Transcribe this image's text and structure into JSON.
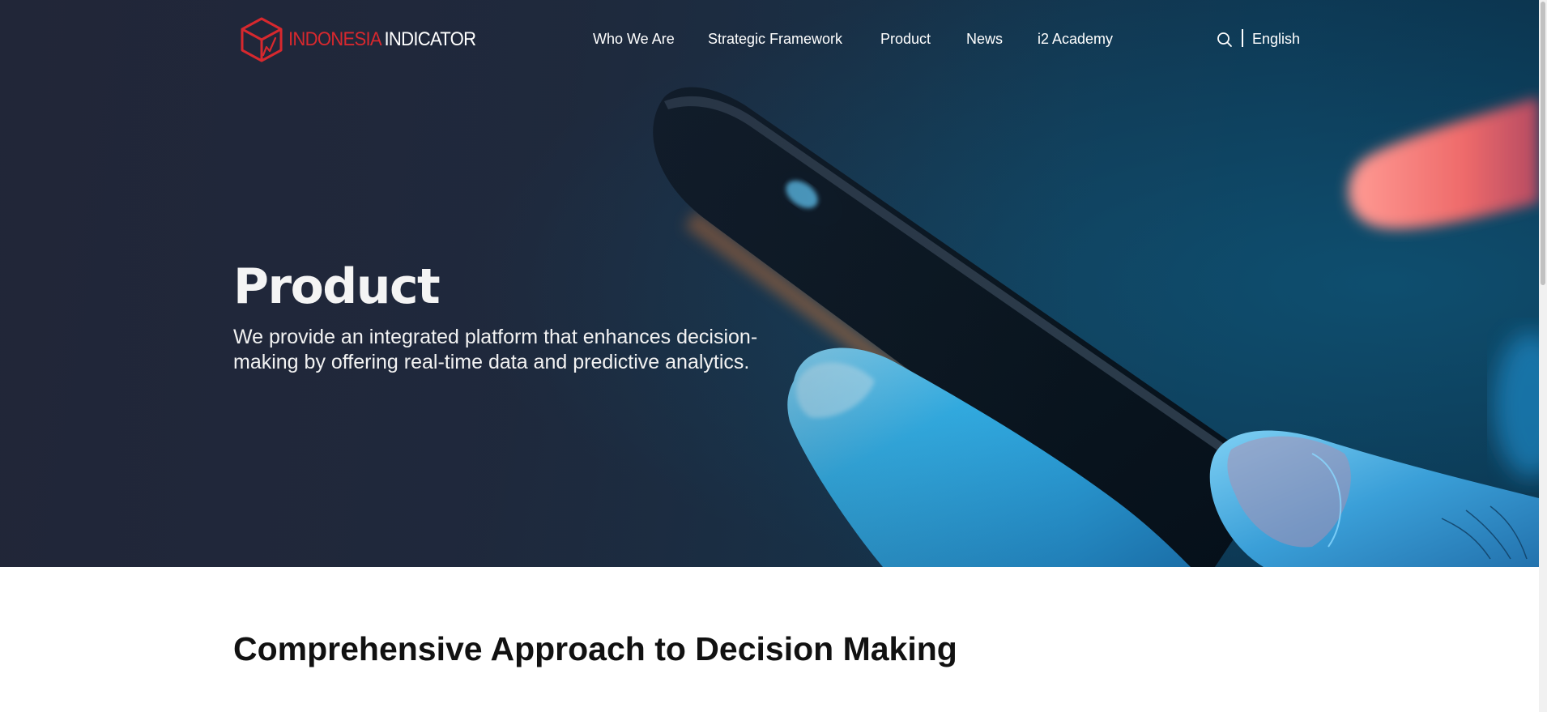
{
  "brand": {
    "name_part1": "INDONESIA",
    "name_part2": "INDICATOR",
    "logo_icon": "cube-chart-logo-icon",
    "accent_color": "#d7282e"
  },
  "nav": {
    "items": [
      {
        "label": "Who We Are"
      },
      {
        "label": "Strategic Framework"
      },
      {
        "label": "Product"
      },
      {
        "label": "News"
      },
      {
        "label": "i2 Academy"
      }
    ],
    "search_icon": "search-icon",
    "language": "English"
  },
  "hero": {
    "title": "Product",
    "description": "We provide an integrated platform that enhances decision-making by offering real-time data and predictive analytics.",
    "image": "hand-holding-smartphone-photo"
  },
  "section": {
    "title": "Comprehensive Approach to Decision Making"
  }
}
